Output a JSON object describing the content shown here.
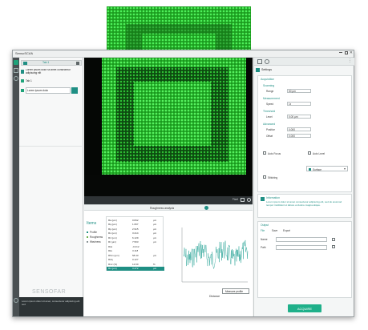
{
  "app": {
    "title": "SensoSCAN"
  },
  "left_panel": {
    "file_name": "Lorem ipsum dolor sit amet consectetur adipiscing elit",
    "tab_name": "Tab 1",
    "selected_item": "Lorem ipsum dolor",
    "logo_text": "SENSOFAR",
    "notice_text": "Lorem ipsum dolor sit amet, consectetur adipiscing elit sed"
  },
  "viewer": {
    "status": "Pixel"
  },
  "bottom_panel": {
    "tab_label": "Roughness analysis",
    "params_title": "Items",
    "legend": [
      "Profile",
      "Roughness",
      "Waviness"
    ],
    "table_rows": [
      {
        "name": "Ra (µm)",
        "value": "0.842",
        "unit": "µm"
      },
      {
        "name": "Rq (µm)",
        "value": "1.067",
        "unit": "µm"
      },
      {
        "name": "Rp (µm)",
        "value": "2.915",
        "unit": "µm"
      },
      {
        "name": "Rv (µm)",
        "value": "3.214",
        "unit": "µm"
      },
      {
        "name": "Rz (µm)",
        "value": "6.129",
        "unit": "µm"
      },
      {
        "name": "Rt (µm)",
        "value": "7.503",
        "unit": "µm"
      },
      {
        "name": "Rsk",
        "value": "-0.212",
        "unit": ""
      },
      {
        "name": "Rku",
        "value": "3.118",
        "unit": ""
      },
      {
        "name": "RSm (µm)",
        "value": "58.43",
        "unit": "µm"
      },
      {
        "name": "Rdq",
        "value": "0.127",
        "unit": ""
      },
      {
        "name": "Rmr (%)",
        "value": "12.60",
        "unit": "%"
      },
      {
        "name": "Rc (µm)",
        "value": "3.472",
        "unit": "µm"
      }
    ],
    "chart_button": "Measure profile",
    "chart_xlabel": "Distance"
  },
  "right_panel": {
    "header": "Settings",
    "section_title": "Acquisition",
    "groups": [
      {
        "title": "Scanning",
        "rows": [
          {
            "label": "Range",
            "value": "50 µm"
          }
        ]
      },
      {
        "title": "Measurement",
        "rows": [
          {
            "label": "Speed",
            "value": "1x"
          }
        ]
      },
      {
        "title": "Threshold",
        "rows": [
          {
            "label": "Level",
            "value": "0.00 µm"
          }
        ]
      },
      {
        "title": "Advanced",
        "rows": [
          {
            "label": "Position",
            "value": "0.000"
          },
          {
            "label": "Offset",
            "value": "0.000"
          }
        ]
      }
    ],
    "options": [
      "Auto Focus",
      "Auto Level"
    ],
    "select_value": "Surface",
    "checkbox_label": "Stitching",
    "info_title": "Information",
    "info_text": "Lorem ipsum dolor sit amet consectetur adipiscing elit, sed do eiusmod tempor incididunt ut labore et dolore magna aliqua.",
    "output_title": "Output",
    "output_tabs": [
      "File",
      "Save",
      "Export"
    ],
    "field_labels": [
      "Name",
      "Path"
    ],
    "acquire_button": "ACQUIRE"
  },
  "colors": {
    "accent": "#1f8f84",
    "green": "#22d12c",
    "dark": "#2f3436"
  }
}
